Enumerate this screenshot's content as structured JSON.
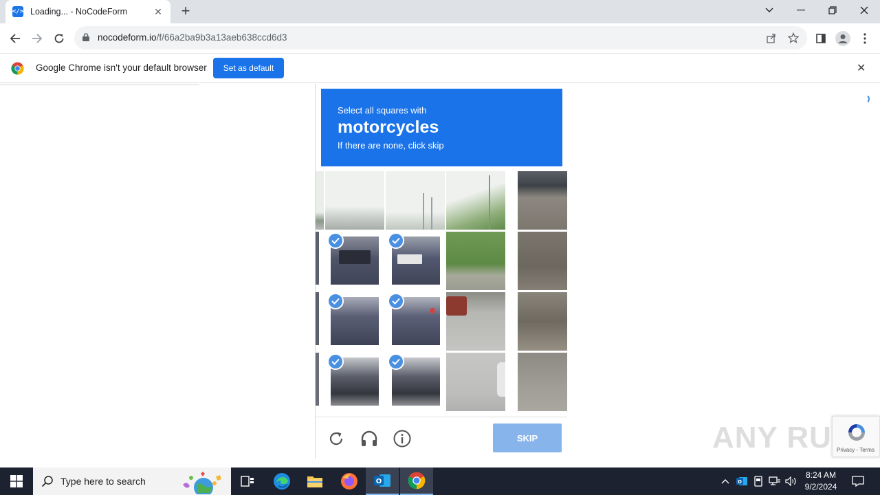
{
  "browser": {
    "tab_title": "Loading... - NoCodeForm",
    "favicon_text": "</>",
    "url_host": "nocodeform.io",
    "url_path": "/f/66a2ba9b3a13aeb638ccd6d3"
  },
  "infobar": {
    "message": "Google Chrome isn't your default browser",
    "set_default_label": "Set as default"
  },
  "captcha": {
    "prompt_line1": "Select all squares with",
    "prompt_target": "motorcycles",
    "prompt_line3": "If there are none, click skip",
    "skip_label": "SKIP",
    "selected_tiles": 6
  },
  "page": {
    "recaptcha_terms": "Privacy - Terms",
    "watermark": "ANY RUN"
  },
  "taskbar": {
    "search_placeholder": "Type here to search",
    "time": "8:24 AM",
    "date": "9/2/2024"
  },
  "colors": {
    "accent": "#1a73e8",
    "check": "#4a90e2",
    "skip_disabled": "#88b4ec"
  }
}
